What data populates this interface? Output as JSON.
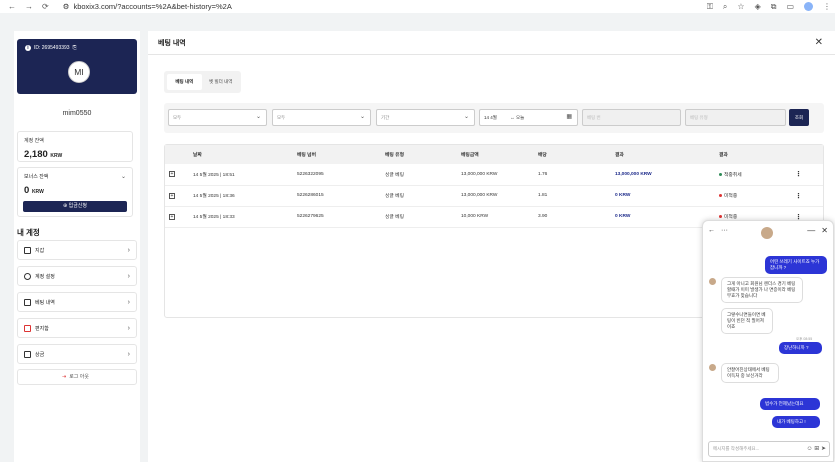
{
  "browser": {
    "url": "kboxix3.com/?accounts=%2A&bet-history=%2A"
  },
  "sidebar": {
    "id_label": "ID: 2695493393",
    "avatar_initials": "MI",
    "username": "mim0550",
    "balance_label": "계정 잔액",
    "balance_amount": "2,180",
    "balance_currency": "KRW",
    "bonus_label": "보너스 잔액",
    "bonus_amount": "0",
    "bonus_currency": "KRW",
    "deposit_button": "입금신청",
    "section_title": "내 계정",
    "items": [
      {
        "label": "지갑"
      },
      {
        "label": "계정 설정"
      },
      {
        "label": "베팅 내역"
      },
      {
        "label": "편지함"
      },
      {
        "label": "상금"
      }
    ],
    "logout": "로그 아웃"
  },
  "main": {
    "title": "베팅 내역",
    "tabs": [
      {
        "label": "베팅 내역"
      },
      {
        "label": "벳 빌더 내역"
      }
    ],
    "filters": {
      "f1": "모두",
      "f2": "모두",
      "f3": "기간",
      "date_from": "14 4월",
      "date_to": "오늘",
      "input1_placeholder": "베팅 번",
      "input2_placeholder": "베팅 유형",
      "search_button": "조회"
    },
    "table": {
      "headers": [
        "",
        "날짜",
        "베팅 넘버",
        "베팅 유형",
        "베팅금액",
        "배당",
        "결과",
        "결과",
        ""
      ],
      "rows": [
        {
          "date": "14 5월 2025 | 18:51",
          "bet_no": "5226322095",
          "type": "싱글 베팅",
          "amount": "13,000,000 KRW",
          "odds": "1.76",
          "result": "13,000,000 KRW",
          "status": "적중취세"
        },
        {
          "date": "14 5월 2025 | 18:36",
          "bet_no": "5226286015",
          "type": "싱글 베팅",
          "amount": "13,000,000 KRW",
          "odds": "1.81",
          "result": "0 KRW",
          "status": "미적중"
        },
        {
          "date": "14 5월 2025 | 18:33",
          "bet_no": "5226279625",
          "type": "싱글 베팅",
          "amount": "10,000 KRW",
          "odds": "3.90",
          "result": "0 KRW",
          "status": "미적중"
        }
      ]
    }
  },
  "chat": {
    "messages": [
      {
        "dir": "out",
        "text": "어떤 쓰레기 사이트죠 누가 잡니까 ?"
      },
      {
        "dir": "in",
        "text": "그게 아니고 회원님 렌더스 경기 베팅할때가 이미 발생가 나 면증이라 베팅 무효가 맞습니다"
      },
      {
        "dir": "in",
        "text": "그렇수나면들이면 베팅이 빈던 적 필어져이죠"
      },
      {
        "dir": "out",
        "text": "장난하니까 ?"
      },
      {
        "dir": "in",
        "text": "안잘어진상태에서 베팅 이득처 중 보신거라"
      },
      {
        "dir": "out",
        "text": "범수가 언제났는데요"
      },
      {
        "dir": "out",
        "text": "내가 베팅하고 !"
      }
    ],
    "time_label": "오후 08:55",
    "input_placeholder": "메시지를 작성해주세요...",
    "status_colors": {
      "win": "#2e8b57",
      "lose": "#d33"
    }
  }
}
